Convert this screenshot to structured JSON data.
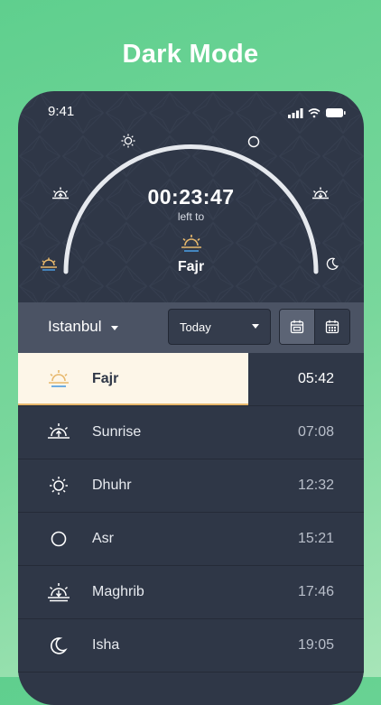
{
  "headline": "Dark Mode",
  "status_bar": {
    "time": "9:41"
  },
  "countdown": {
    "remaining": "00:23:47",
    "caption": "left to",
    "next_prayer": "Fajr"
  },
  "toolbar": {
    "city": "Istanbul",
    "range_select": "Today",
    "view_toggle": [
      "day-calendar-icon",
      "month-calendar-icon"
    ]
  },
  "prayers": [
    {
      "name": "Fajr",
      "time": "05:42",
      "icon": "fajr-icon",
      "active": true
    },
    {
      "name": "Sunrise",
      "time": "07:08",
      "icon": "sunrise-icon"
    },
    {
      "name": "Dhuhr",
      "time": "12:32",
      "icon": "sun-icon"
    },
    {
      "name": "Asr",
      "time": "15:21",
      "icon": "circle-icon"
    },
    {
      "name": "Maghrib",
      "time": "17:46",
      "icon": "sunset-icon"
    },
    {
      "name": "Isha",
      "time": "19:05",
      "icon": "moon-icon"
    }
  ],
  "colors": {
    "background": "#6fd497",
    "panel": "#2f3747",
    "toolbar": "#4b5364",
    "highlight": "#fdf6e8",
    "accent_gold": "#e7b86c",
    "accent_blue": "#4a9be0"
  }
}
